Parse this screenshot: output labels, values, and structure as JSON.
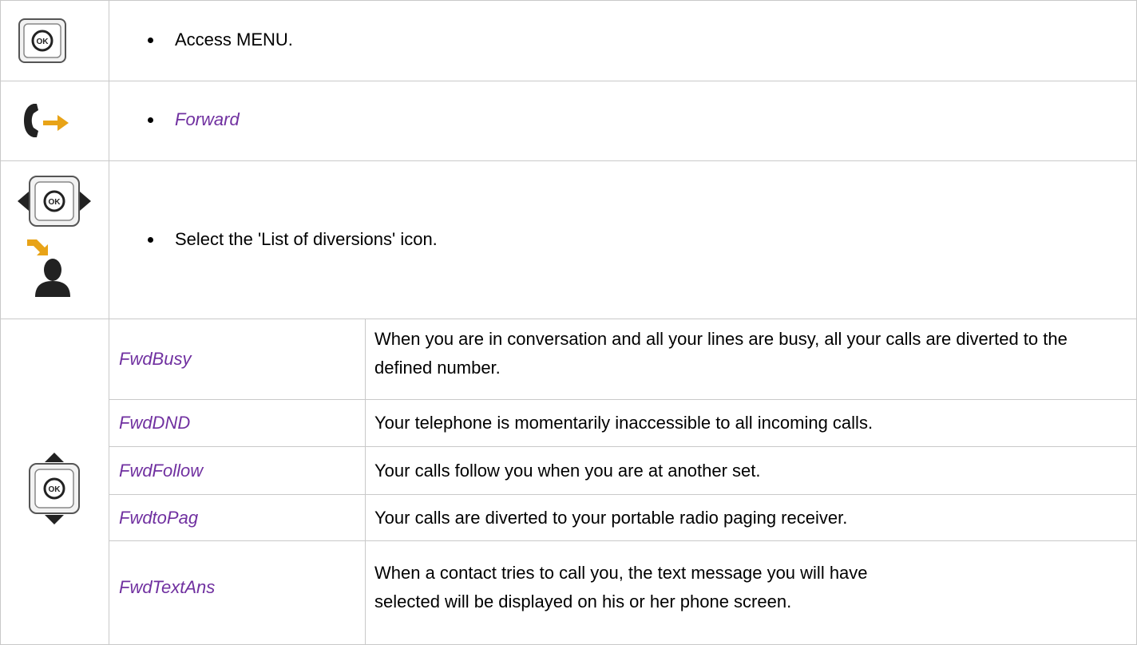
{
  "steps": [
    {
      "text": "Access MENU.",
      "icon": "ok-button-icon"
    },
    {
      "text": "Forward",
      "icon": "call-forward-icon"
    },
    {
      "text": "Select the 'List of diversions' icon.",
      "icon": "navigator-left-right-icon"
    }
  ],
  "options": {
    "icon": "navigator-up-down-icon",
    "rows": [
      {
        "label": "FwdBusy",
        "desc": "When you are in conversation and all your lines are busy, all your calls are diverted to the defined number."
      },
      {
        "label": "FwdDND",
        "desc": "Your telephone is momentarily inaccessible to all incoming calls."
      },
      {
        "label": "FwdFollow",
        "desc": "Your calls follow you when you are at another set."
      },
      {
        "label": "FwdtoPag",
        "desc": "Your calls are diverted to your portable radio paging receiver."
      },
      {
        "label": "FwdTextAns",
        "desc": "When a contact tries to call you, the text message you will have selected will be displayed on his or her phone screen."
      }
    ]
  },
  "colors": {
    "accent": "#7030a0",
    "border": "#c9c9c9",
    "icon_orange": "#e8a317"
  }
}
